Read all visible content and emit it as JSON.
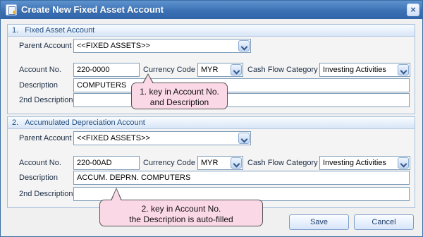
{
  "window": {
    "title": "Create New Fixed Asset Account",
    "close_label": "×",
    "icon": "document-icon"
  },
  "sections": [
    {
      "number": "1.",
      "title": "Fixed Asset Account",
      "parent_account_label": "Parent Account",
      "parent_account_value": "<<FIXED ASSETS>>",
      "account_no_label": "Account No.",
      "account_no_value": "220-0000",
      "currency_code_label": "Currency Code",
      "currency_code_value": "MYR",
      "cash_flow_label": "Cash Flow Category",
      "cash_flow_value": "Investing Activities",
      "description_label": "Description",
      "description_value": "COMPUTERS",
      "second_description_label": "2nd Description",
      "second_description_value": ""
    },
    {
      "number": "2.",
      "title": "Accumulated Depreciation Account",
      "parent_account_label": "Parent Account",
      "parent_account_value": "<<FIXED ASSETS>>",
      "account_no_label": "Account No.",
      "account_no_value": "220-00AD",
      "currency_code_label": "Currency Code",
      "currency_code_value": "MYR",
      "cash_flow_label": "Cash Flow Category",
      "cash_flow_value": "Investing Activities",
      "description_label": "Description",
      "description_value": "ACCUM. DEPRN. COMPUTERS",
      "second_description_label": "2nd Description",
      "second_description_value": ""
    }
  ],
  "callouts": [
    {
      "line1": "1. key in Account No.",
      "line2": "and Description"
    },
    {
      "line1": "2. key in Account No.",
      "line2": "the Description is auto-filled"
    }
  ],
  "buttons": {
    "save": "Save",
    "cancel": "Cancel"
  },
  "colors": {
    "title_bar": "#3c72b5",
    "section_border": "#a7bfdc",
    "callout_fill": "#fbd8e6"
  }
}
